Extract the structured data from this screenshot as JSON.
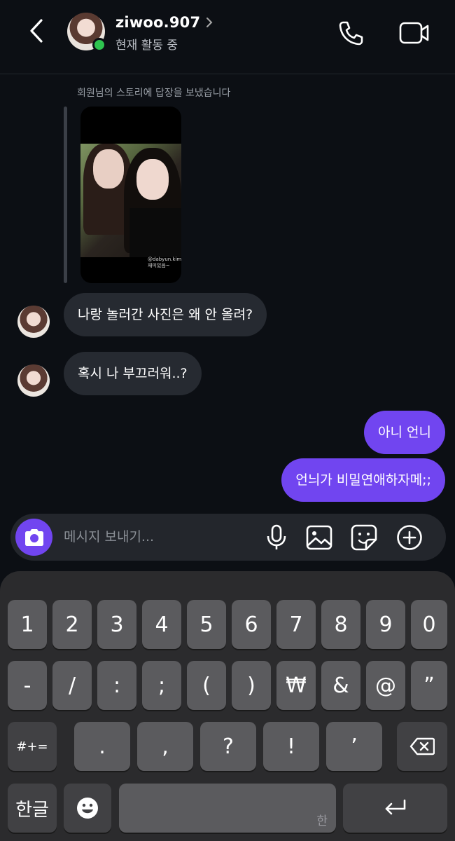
{
  "header": {
    "username": "ziwoo.907",
    "status": "현재 활동 중",
    "icons": [
      "back-icon",
      "chevron-right-icon",
      "phone-icon",
      "video-camera-icon"
    ]
  },
  "chat": {
    "story_caption": "회원님의 스토리에 답장을 보냈습니다",
    "story_tag": "@dabyun.kim",
    "story_tag2": "재미있음~",
    "messages": [
      {
        "side": "in",
        "text": "나랑 놀러간 사진은 왜 안 올려?"
      },
      {
        "side": "in",
        "text": "혹시 나 부끄러워..?"
      },
      {
        "side": "out",
        "text": "아니 언니"
      },
      {
        "side": "out",
        "text": "언늬가 비밀연애하자메;;"
      }
    ],
    "colors": {
      "outgoing": "#7145f0",
      "incoming": "#262a31",
      "online": "#2ec44f"
    }
  },
  "composer": {
    "placeholder": "메시지 보내기...",
    "icons": [
      "camera-icon",
      "microphone-icon",
      "gallery-icon",
      "sticker-icon",
      "plus-circle-icon"
    ]
  },
  "keyboard": {
    "row1": [
      "1",
      "2",
      "3",
      "4",
      "5",
      "6",
      "7",
      "8",
      "9",
      "0"
    ],
    "row2": [
      "-",
      "/",
      ":",
      ";",
      "(",
      ")",
      "₩",
      "&",
      "@",
      "”"
    ],
    "row3": [
      "#+=",
      ".",
      ",",
      "?",
      "!",
      "’"
    ],
    "lang_key": "한글",
    "space_hint": "한",
    "icons": [
      "backspace-icon",
      "emoji-icon",
      "return-icon"
    ]
  }
}
